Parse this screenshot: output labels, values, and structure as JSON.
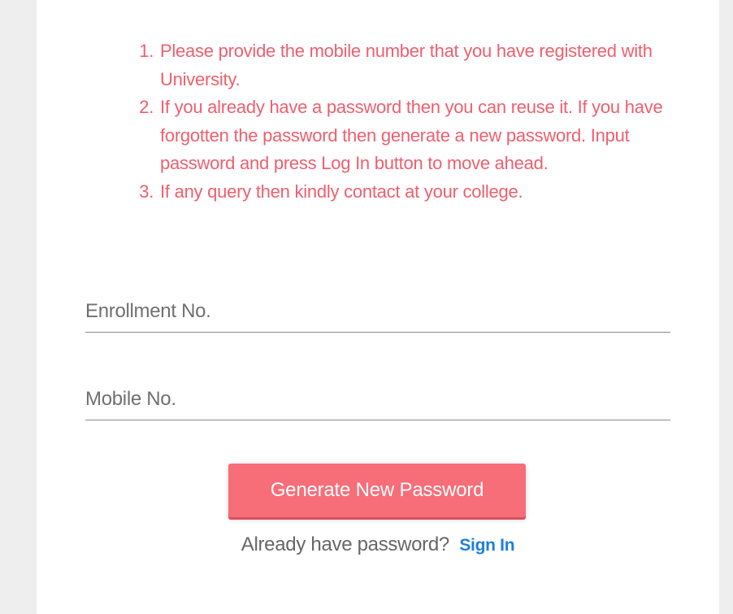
{
  "instructions": [
    "Please provide the mobile number that you have registered with University.",
    "If you already have a password then you can reuse it. If you have forgotten the password then generate a new password. Input password and press Log In button to move ahead.",
    "If any query then kindly contact at your college."
  ],
  "form": {
    "enrollment_placeholder": "Enrollment No.",
    "mobile_placeholder": "Mobile No.",
    "generate_button": "Generate New Password"
  },
  "footer": {
    "question": "Already have password?",
    "signin_link": "Sign In"
  },
  "colors": {
    "instruction_text": "#ee5f6e",
    "button_bg": "#f76d78",
    "link": "#1e7fd8",
    "page_bg": "#eeeeee"
  }
}
